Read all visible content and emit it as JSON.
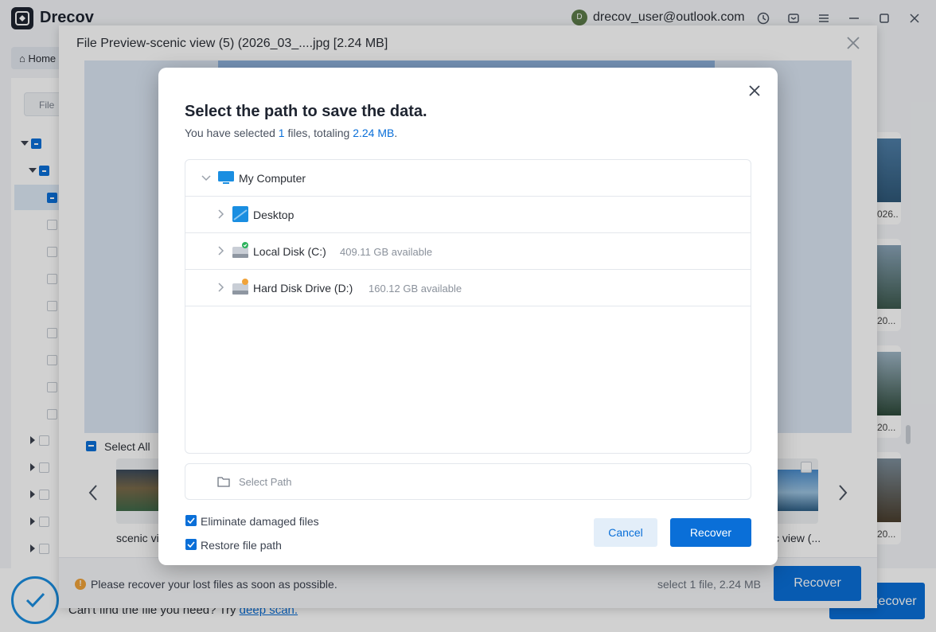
{
  "app": {
    "title": "Drecov",
    "user_initial": "D",
    "user_email": "drecov_user@outlook.com"
  },
  "main": {
    "home_tab": "Home",
    "file_tab": "File",
    "deep_scan_prefix": "Can't find the file you need? Try ",
    "deep_scan_link": "deep scan.",
    "recover_button": "Recover",
    "right_thumb_labels": [
      "026..",
      "20...",
      "20...",
      "20..."
    ]
  },
  "preview": {
    "title": "File Preview-scenic view (5) (2026_03_....jpg [2.24 MB]",
    "select_all": "Select All",
    "thumb_left_label": "scenic vie",
    "thumb_right_label": "c view (...",
    "warning": "Please recover your lost files as soon as possible.",
    "selection_summary": "select 1 file, 2.24 MB",
    "recover_button": "Recover"
  },
  "dialog": {
    "title": "Select the path to save the data.",
    "subtitle_prefix": "You have selected ",
    "subtitle_count": "1",
    "subtitle_middle": " files, totaling ",
    "subtitle_size": "2.24 MB",
    "subtitle_suffix": ".",
    "tree": {
      "root": "My Computer",
      "items": [
        {
          "name": "Desktop",
          "available": ""
        },
        {
          "name": "Local Disk (C:)",
          "available": "409.11 GB available"
        },
        {
          "name": "Hard Disk Drive (D:)",
          "available": "160.12 GB available"
        }
      ]
    },
    "select_path_placeholder": "Select Path",
    "options": [
      {
        "label": "Eliminate damaged files",
        "checked": true
      },
      {
        "label": "Restore file path",
        "checked": true
      }
    ],
    "cancel_button": "Cancel",
    "recover_button": "Recover"
  },
  "colors": {
    "accent": "#0a6fd8",
    "warning": "#f0a33a"
  }
}
